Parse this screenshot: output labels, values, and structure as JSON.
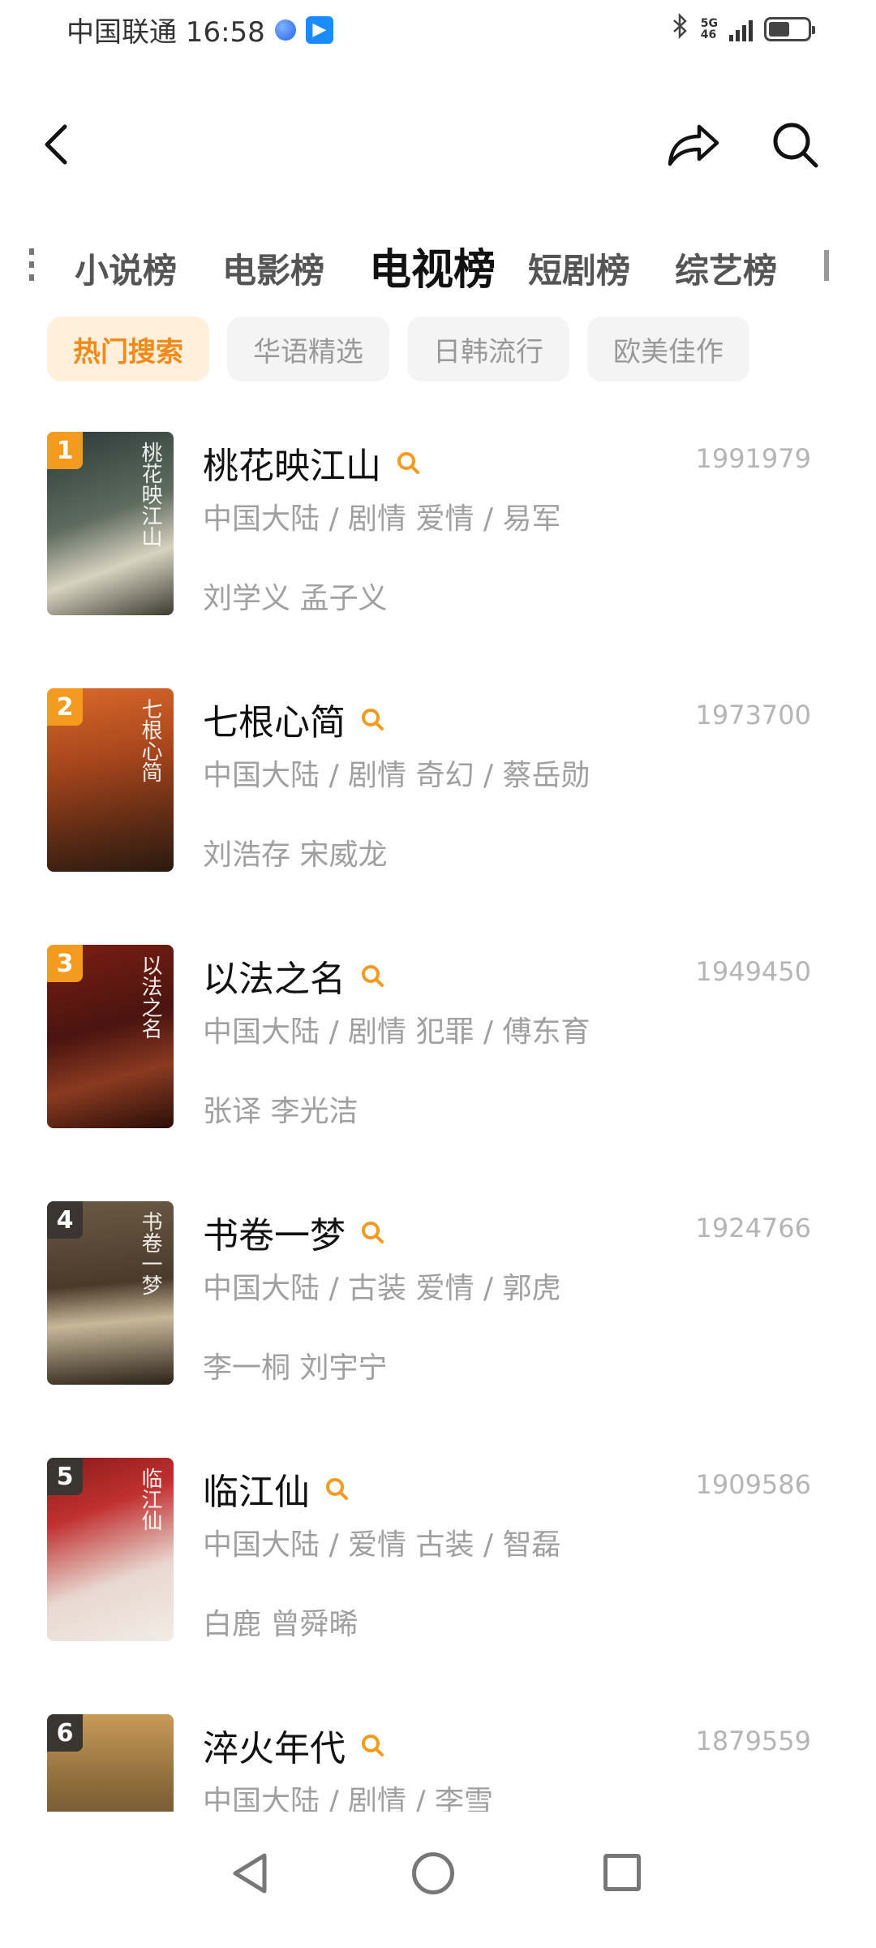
{
  "status_bar": {
    "carrier_time": "中国联通 16:58",
    "app_badge": "▶",
    "network": [
      "5G",
      "46"
    ],
    "battery_level": 0.55,
    "icons": [
      "globe-icon",
      "app-badge-icon",
      "bluetooth-icon",
      "signal-icon",
      "battery-icon"
    ]
  },
  "top_bar": {
    "icons": [
      "back-icon",
      "share-icon",
      "search-icon"
    ]
  },
  "category_tabs": [
    {
      "label": "小说榜"
    },
    {
      "label": "电影榜"
    },
    {
      "label": "电视榜",
      "active": true
    },
    {
      "label": "短剧榜"
    },
    {
      "label": "综艺榜"
    }
  ],
  "sub_tabs": [
    {
      "label": "热门搜索",
      "active": true
    },
    {
      "label": "华语精选"
    },
    {
      "label": "日韩流行"
    },
    {
      "label": "欧美佳作"
    }
  ],
  "items": [
    {
      "rank": "1",
      "title": "桃花映江山",
      "count": "1991979",
      "meta": "中国大陆 / 剧情 爱情 / 易军",
      "cast": "刘学义 孟子义",
      "poster_text": "桃花映江山"
    },
    {
      "rank": "2",
      "title": "七根心简",
      "count": "1973700",
      "meta": "中国大陆 / 剧情 奇幻 / 蔡岳勋",
      "cast": "刘浩存 宋威龙",
      "poster_text": "七根心简"
    },
    {
      "rank": "3",
      "title": "以法之名",
      "count": "1949450",
      "meta": "中国大陆 / 剧情 犯罪 / 傅东育",
      "cast": "张译 李光洁",
      "poster_text": "以法之名"
    },
    {
      "rank": "4",
      "title": "书卷一梦",
      "count": "1924766",
      "meta": "中国大陆 / 古装 爱情 / 郭虎",
      "cast": "李一桐 刘宇宁",
      "poster_text": "书卷一梦"
    },
    {
      "rank": "5",
      "title": "临江仙",
      "count": "1909586",
      "meta": "中国大陆 / 爱情 古装 / 智磊",
      "cast": "白鹿 曾舜晞",
      "poster_text": "临江仙"
    },
    {
      "rank": "6",
      "title": "淬火年代",
      "count": "1879559",
      "meta": "中国大陆 / 剧情 / 李雪",
      "cast": "",
      "poster_text": ""
    }
  ],
  "accent_color": "#f39a1f",
  "nav_bar": {
    "icons": [
      "nav-back-icon",
      "nav-home-icon",
      "nav-recent-icon"
    ]
  }
}
